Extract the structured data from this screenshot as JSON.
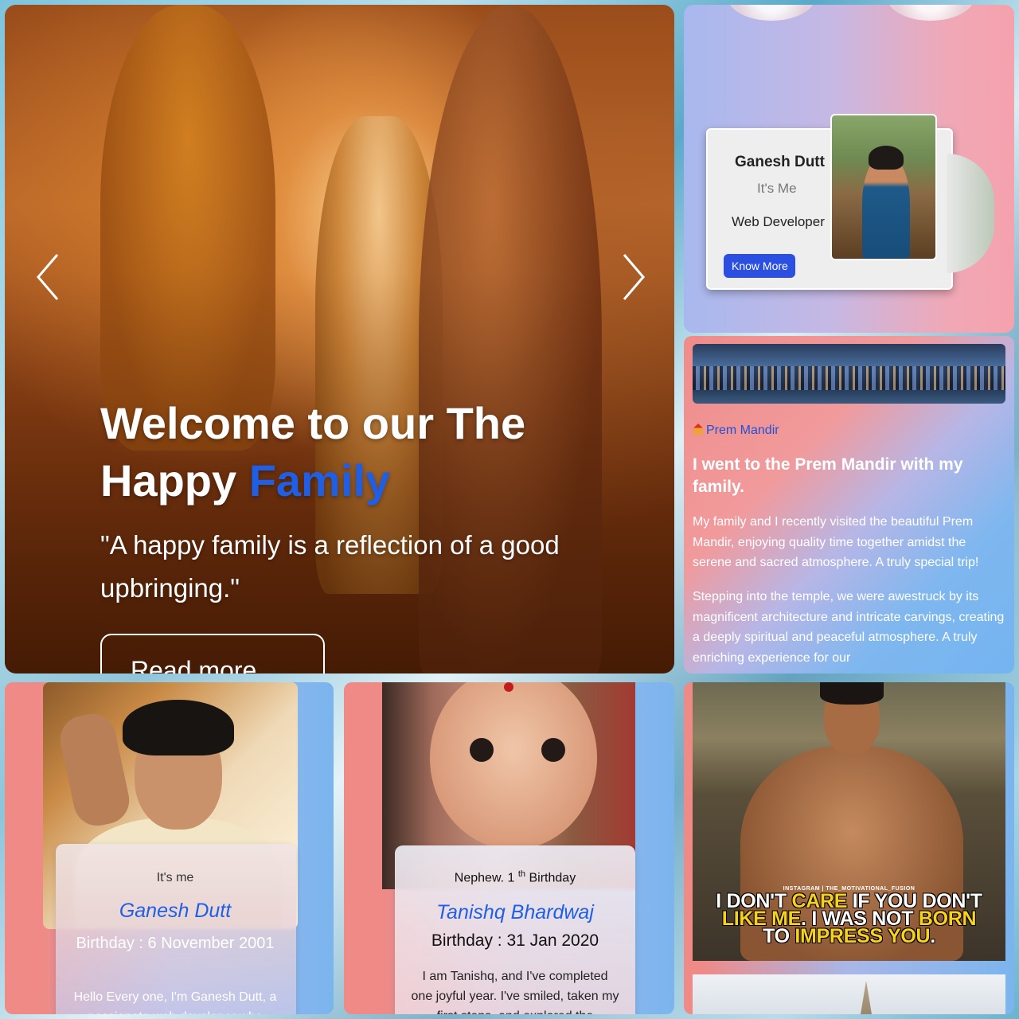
{
  "hero": {
    "title_part1": "Welcome to our The Happy ",
    "title_highlight": "Family",
    "quote": "\"A happy family is a reflection of a good upbringing.\"",
    "read_more": "Read more"
  },
  "profile": {
    "name": "Ganesh Dutt",
    "subtitle": "It's Me",
    "role": "Web Developer",
    "button": "Know More"
  },
  "blog": {
    "tag": "Prem Mandir",
    "title": "I went to the Prem Mandir with my family.",
    "para1": "My family and I recently visited the beautiful Prem Mandir, enjoying quality time together amidst the serene and sacred atmosphere. A truly special trip!",
    "para2": "Stepping into the temple, we were awestruck by its magnificent architecture and intricate carvings, creating a deeply spiritual and peaceful atmosphere. A truly enriching experience for our"
  },
  "card_ganesh": {
    "label": "It's me",
    "name": "Ganesh Dutt",
    "birthday": "Birthday : 6 November 2001",
    "text": "Hello Every one, I'm Ganesh Dutt, a passionate web developer who"
  },
  "card_tanishq": {
    "label_main": "Nephew. 1",
    "label_sup": "th",
    "label_tail": " Birthday",
    "name": "Tanishq Bhardwaj",
    "birthday": "Birthday : 31 Jan 2020",
    "text": "I am Tanishq, and I've completed one joyful year. I've smiled, taken my first steps, and explored the"
  },
  "card_quote": {
    "credit": "INSTAGRAM | THE_MOTIVATIONAL_FUSION",
    "line1_a": "I DON'T ",
    "line1_b": "CARE",
    "line1_c": " IF YOU DON'T",
    "line2_a": "LIKE ME",
    "line2_b": ". I WAS NOT ",
    "line2_c": "BORN",
    "line3_a": "TO ",
    "line3_b": "IMPRESS YOU",
    "line3_c": "."
  }
}
